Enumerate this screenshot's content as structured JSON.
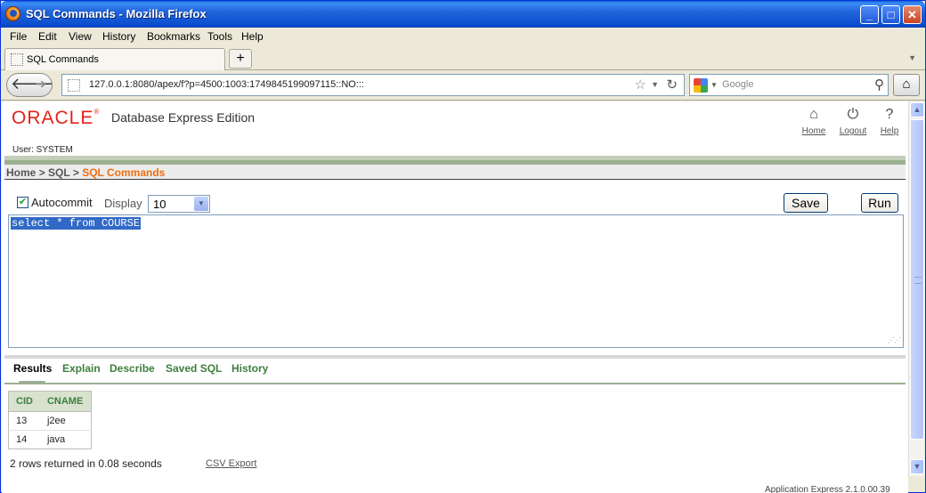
{
  "window": {
    "title": "SQL Commands - Mozilla Firefox"
  },
  "menu": [
    "File",
    "Edit",
    "View",
    "History",
    "Bookmarks",
    "Tools",
    "Help"
  ],
  "tabs": [
    {
      "label": "SQL Commands"
    }
  ],
  "new_tab_label": "+",
  "nav": {
    "url": "127.0.0.1:8080/apex/f?p=4500:1003:1749845199097115::NO:::",
    "search_placeholder": "Google"
  },
  "app": {
    "logo_text": "ORACLE",
    "product_name": "Database Express Edition",
    "user_line": "User: SYSTEM",
    "header_links": [
      {
        "label": "Home",
        "icon": "home-icon"
      },
      {
        "label": "Logout",
        "icon": "power-icon"
      },
      {
        "label": "Help",
        "icon": "help-icon"
      }
    ]
  },
  "breadcrumb": {
    "home": "Home",
    "sql": "SQL",
    "current": "SQL Commands",
    "sep": ">"
  },
  "commands": {
    "autocommit_label": "Autocommit",
    "autocommit_checked": true,
    "display_label": "Display",
    "display_value": "10",
    "save_label": "Save",
    "run_label": "Run",
    "sql_text": "select * from COURSE"
  },
  "result_tabs": [
    "Results",
    "Explain",
    "Describe",
    "Saved SQL",
    "History"
  ],
  "results": {
    "columns": [
      "CID",
      "CNAME"
    ],
    "rows": [
      [
        "13",
        "j2ee"
      ],
      [
        "14",
        "java"
      ]
    ],
    "summary": "2 rows returned in 0.08 seconds",
    "csv_export": "CSV Export"
  },
  "footer": {
    "version": "Application Express 2.1.0.00.39"
  },
  "colors": {
    "oracle_red": "#e2231a",
    "breadcrumb_current": "#ee6e10",
    "tab_green": "#3d7f3d",
    "selection": "#3169c6"
  }
}
